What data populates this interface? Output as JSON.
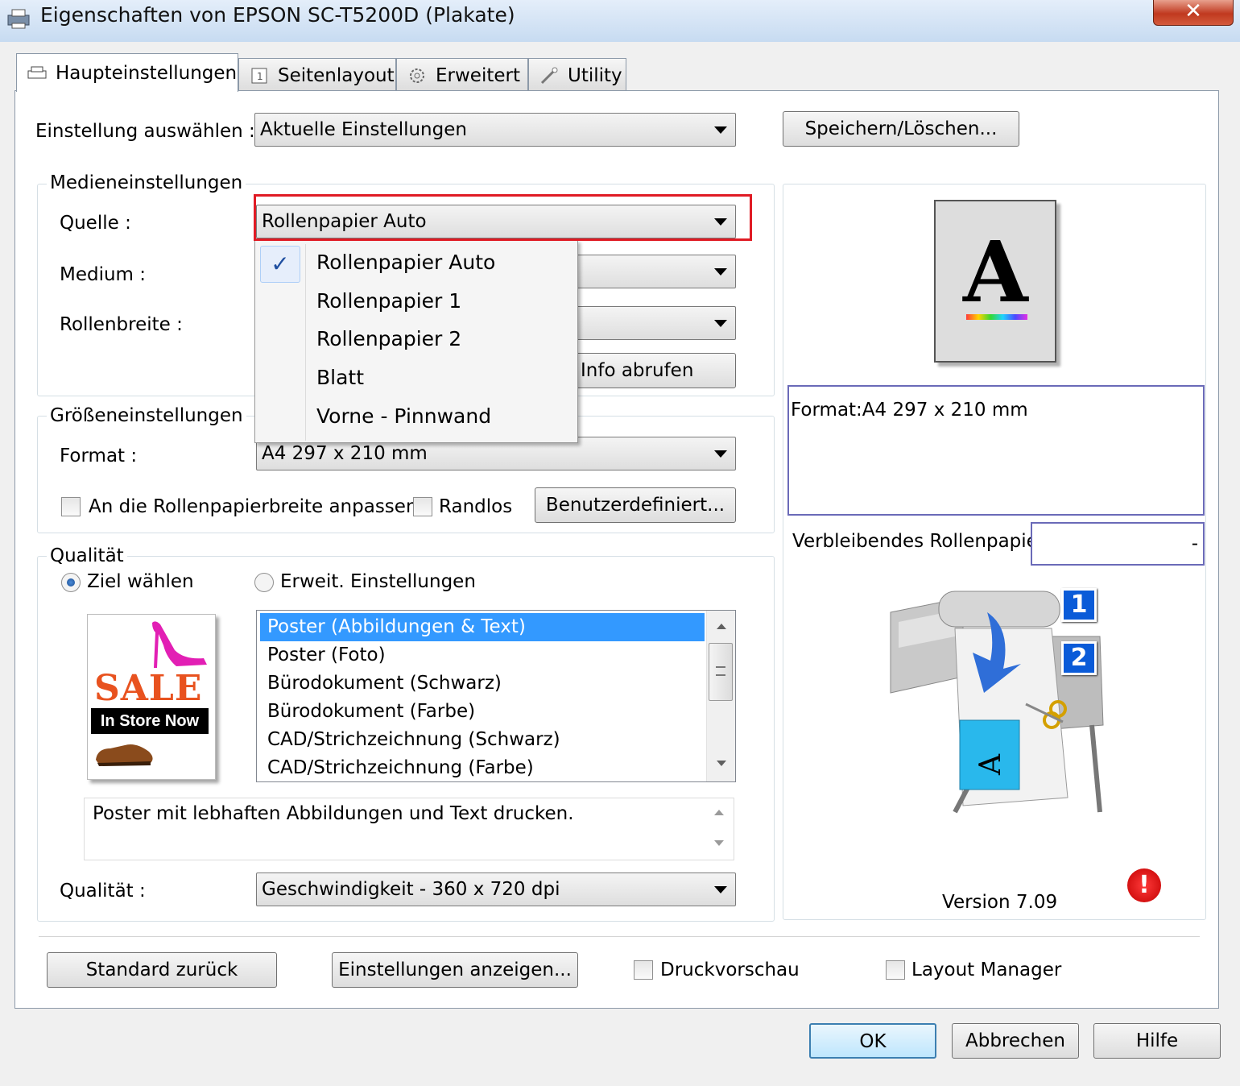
{
  "window": {
    "title": "Eigenschaften von EPSON SC-T5200D (Plakate)",
    "close_glyph": "✕"
  },
  "tabs": [
    {
      "label": "Haupteinstellungen",
      "icon": "printer-icon"
    },
    {
      "label": "Seitenlayout",
      "icon": "page-layout-icon"
    },
    {
      "label": "Erweitert",
      "icon": "gear-icon"
    },
    {
      "label": "Utility",
      "icon": "wrench-icon"
    }
  ],
  "settings": {
    "select_label": "Einstellung auswählen :",
    "select_value": "Aktuelle Einstellungen",
    "save_button": "Speichern/Löschen..."
  },
  "media": {
    "group_title": "Medieneinstellungen",
    "source_label": "Quelle :",
    "source_value": "Rollenpapier Auto",
    "medium_label": "Medium :",
    "rollwidth_label": "Rollenbreite :",
    "info_button": "Info abrufen",
    "source_options": [
      "Rollenpapier Auto",
      "Rollenpapier 1",
      "Rollenpapier 2",
      "Blatt",
      "Vorne - Pinnwand"
    ],
    "selected_option_index": 0,
    "check_glyph": "✓"
  },
  "size": {
    "group_title": "Größeneinstellungen",
    "format_label": "Format :",
    "format_value": "A4 297 x 210 mm",
    "fit_roll_label": "An die Rollenpapierbreite anpassen",
    "borderless_label": "Randlos",
    "custom_button": "Benutzerdefiniert..."
  },
  "quality": {
    "group_title": "Qualität",
    "radio_target": "Ziel wählen",
    "radio_advanced": "Erweit. Einstellungen",
    "selected_radio": "target",
    "targets": [
      "Poster (Abbildungen & Text)",
      "Poster (Foto)",
      "Bürodokument (Schwarz)",
      "Bürodokument (Farbe)",
      "CAD/Strichzeichnung (Schwarz)",
      "CAD/Strichzeichnung (Farbe)"
    ],
    "selected_target_index": 0,
    "description": "Poster mit lebhaften Abbildungen und Text drucken.",
    "quality_label": "Qualität :",
    "quality_value": "Geschwindigkeit - 360 x 720 dpi",
    "sale_image": {
      "sale_text": "SALE",
      "banner_text": "In Store Now"
    }
  },
  "preview": {
    "page_letter": "A",
    "format_text": "Format:A4 297 x 210 mm",
    "remaining_label": "Verbleibendes Rollenpapier:",
    "remaining_value": "-",
    "roll_badge_1": "1",
    "roll_badge_2": "2",
    "output_letter": "A",
    "version": "Version 7.09",
    "alert_glyph": "!"
  },
  "bottom": {
    "reset_button": "Standard zurück",
    "show_settings_button": "Einstellungen anzeigen...",
    "print_preview_label": "Druckvorschau",
    "layout_manager_label": "Layout Manager"
  },
  "footer": {
    "ok": "OK",
    "cancel": "Abbrechen",
    "help": "Hilfe"
  },
  "colors": {
    "selection": "#3399ff",
    "highlight_border": "#e01b24",
    "badge": "#0a5bd8"
  }
}
